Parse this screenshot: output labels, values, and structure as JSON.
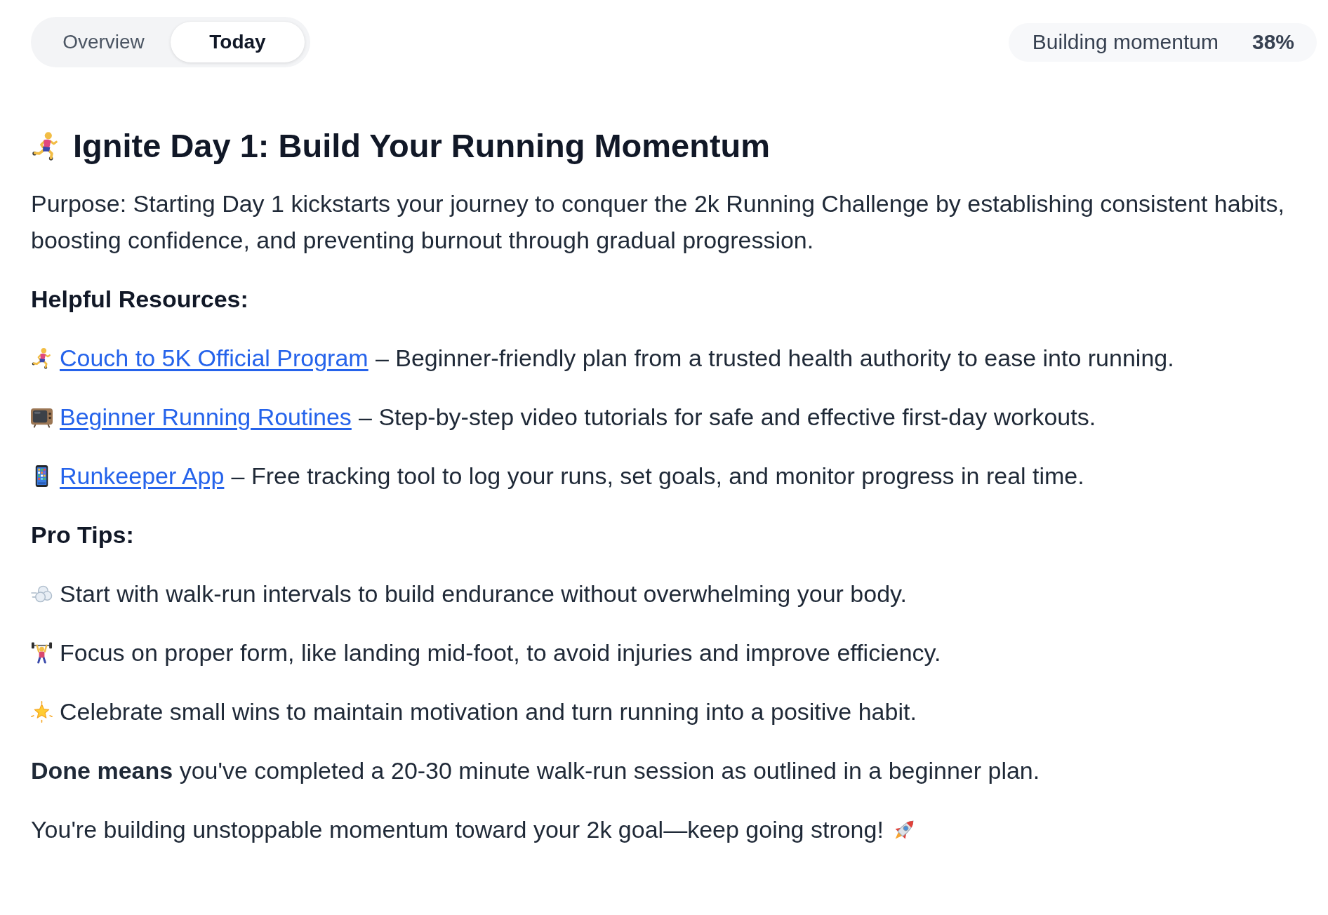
{
  "tabs": [
    {
      "label": "Overview",
      "selected": false
    },
    {
      "label": "Today",
      "selected": true
    }
  ],
  "status": {
    "label": "Building momentum",
    "value": "38%"
  },
  "title": {
    "kind": "runner",
    "text": "Ignite Day 1: Build Your Running Momentum"
  },
  "purpose": "Purpose: Starting Day 1 kickstarts your journey to conquer the 2k Running Challenge by establishing consistent habits, boosting confidence, and preventing burnout through gradual progression.",
  "resources": {
    "heading": "Helpful Resources:",
    "items": [
      {
        "kind": "runner",
        "link": "Couch to 5K Official Program",
        "description": "– Beginner-friendly plan from a trusted health authority to ease into running."
      },
      {
        "kind": "tv",
        "link": "Beginner Running Routines",
        "description": "– Step-by-step video tutorials for safe and effective first-day workouts."
      },
      {
        "kind": "phone",
        "link": "Runkeeper App",
        "description": "– Free tracking tool to log your runs, set goals, and monitor progress in real time."
      }
    ]
  },
  "tips": {
    "heading": "Pro Tips:",
    "items": [
      {
        "kind": "puff",
        "text": "Start with walk-run intervals to build endurance without overwhelming your body."
      },
      {
        "kind": "lifter",
        "text": "Focus on proper form, like landing mid-foot, to avoid injuries and improve efficiency."
      },
      {
        "kind": "star",
        "text": "Celebrate small wins to maintain motivation and turn running into a positive habit."
      }
    ]
  },
  "done": "**Done means** you've completed a 20-30 minute walk-run session as outlined in a beginner plan.",
  "closing": {
    "text": "You're building unstoppable momentum toward your 2k goal—keep going strong!",
    "kind": "rocket"
  }
}
